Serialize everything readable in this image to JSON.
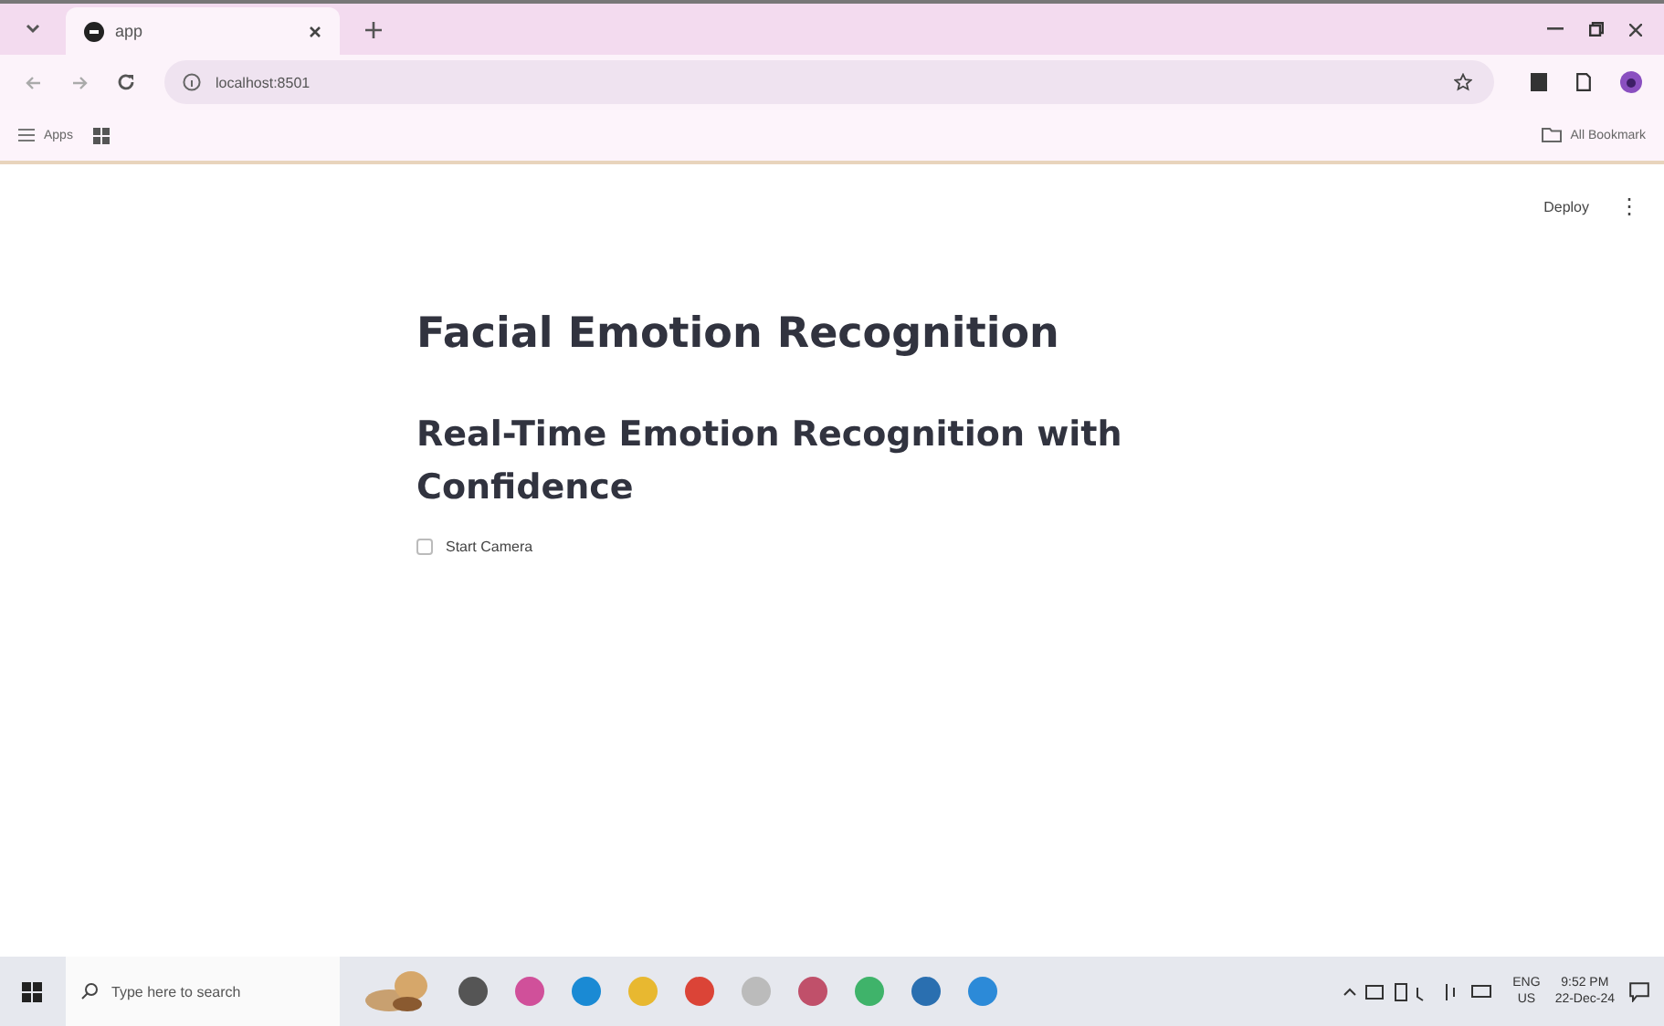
{
  "browser": {
    "tab": {
      "title": "app"
    },
    "address": "localhost:8501",
    "bookmarks": {
      "apps_label": "Apps",
      "all_label": "All Bookmark"
    }
  },
  "app": {
    "deploy": "Deploy",
    "menu": "⋮",
    "title": "Facial Emotion Recognition",
    "subtitle": "Real-Time Emotion Recognition with Confidence",
    "checkbox": {
      "label": "Start Camera",
      "checked": false
    }
  },
  "taskbar": {
    "search_placeholder": "Type here to search",
    "language": "ENG",
    "region": "US",
    "time": "9:52 PM",
    "date": "22-Dec-24"
  }
}
